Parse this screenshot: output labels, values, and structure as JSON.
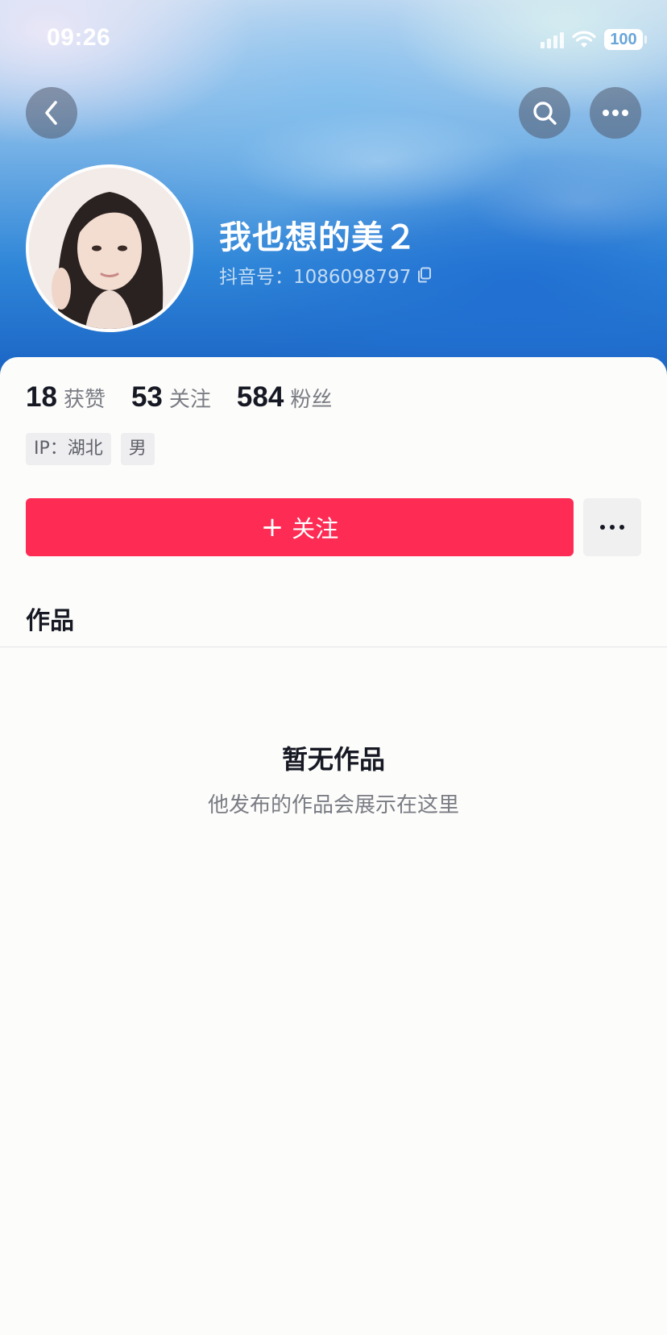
{
  "status_bar": {
    "time": "09:26",
    "battery": "100"
  },
  "header": {
    "back_icon": "chevron-left-icon",
    "search_icon": "search-icon",
    "more_icon": "ellipsis-icon"
  },
  "profile": {
    "nickname": "我也想的美２",
    "douyin_id": "抖音号：1086098797",
    "copy_icon": "copy-icon"
  },
  "stats": [
    {
      "value": "18",
      "label": "获赞"
    },
    {
      "value": "53",
      "label": "关注"
    },
    {
      "value": "584",
      "label": "粉丝"
    }
  ],
  "tags": [
    "IP：湖北",
    "男"
  ],
  "actions": {
    "follow_plus": "+",
    "follow_label": "关注",
    "more_icon": "ellipsis-icon"
  },
  "tabs": {
    "works": "作品"
  },
  "empty_state": {
    "title": "暂无作品",
    "subtitle": "他发布的作品会展示在这里"
  },
  "colors": {
    "accent": "#fe2c55",
    "banner": "#2f86d8",
    "text": "#161823",
    "muted": "#7a7c84"
  }
}
